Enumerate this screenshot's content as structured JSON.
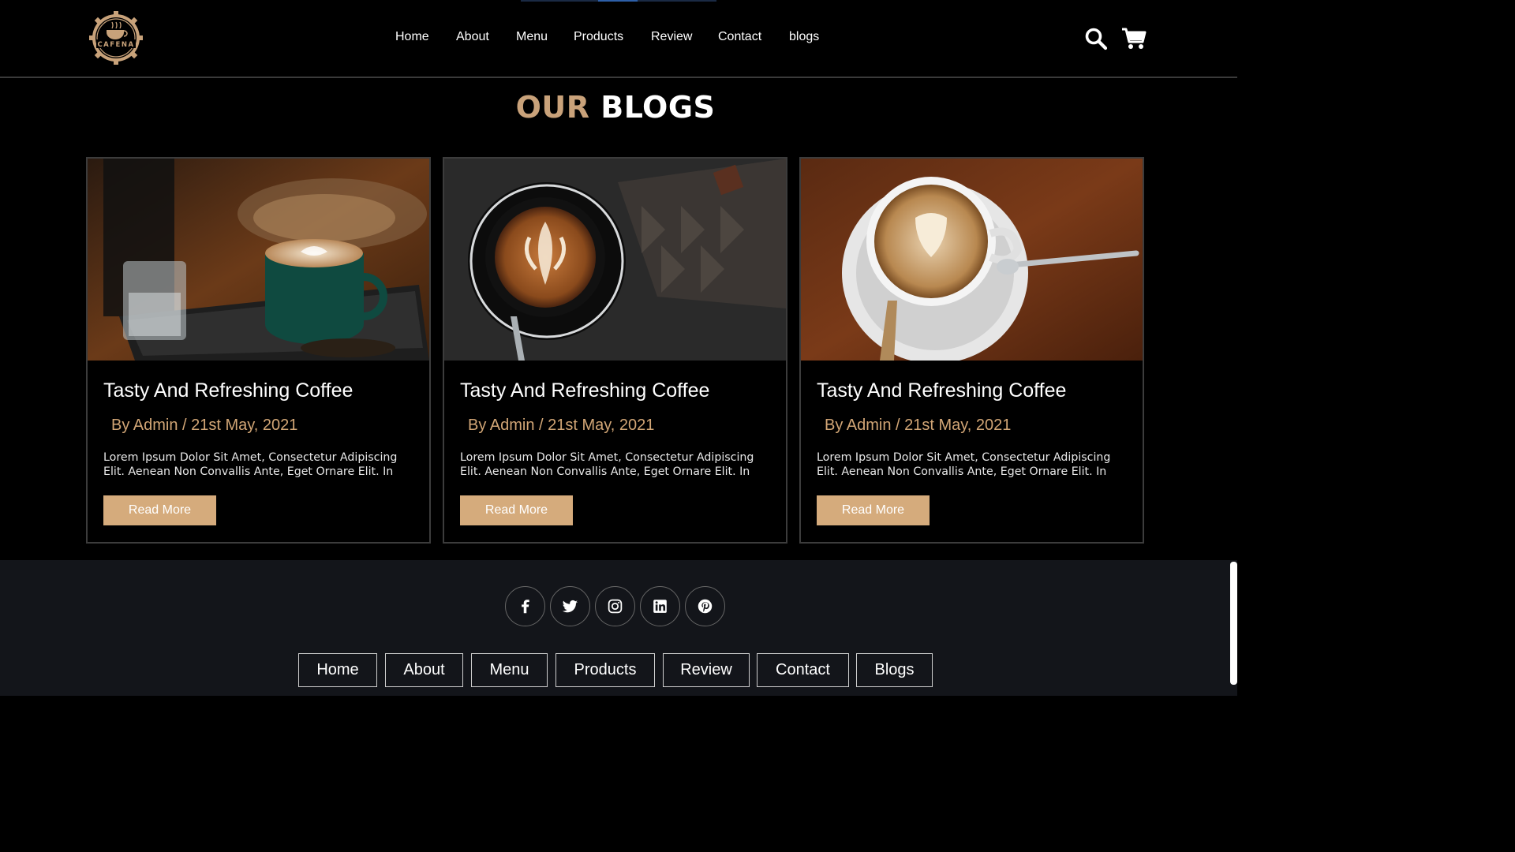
{
  "brand": {
    "logo_text": "CAFENA"
  },
  "nav": {
    "items": [
      "Home",
      "About",
      "Menu",
      "Products",
      "Review",
      "Contact",
      "blogs"
    ]
  },
  "header_icons": [
    "search-icon",
    "cart-icon"
  ],
  "section": {
    "title_accent": "OUR",
    "title_rest": "BLOGS"
  },
  "blogs": [
    {
      "title": "Tasty And Refreshing Coffee",
      "meta": "By Admin / 21st May, 2021",
      "excerpt": "Lorem Ipsum Dolor Sit Amet, Consectetur Adipiscing Elit. Aenean Non Convallis Ante, Eget Ornare Elit. In",
      "button": "Read More"
    },
    {
      "title": "Tasty And Refreshing Coffee",
      "meta": "By Admin / 21st May, 2021",
      "excerpt": "Lorem Ipsum Dolor Sit Amet, Consectetur Adipiscing Elit. Aenean Non Convallis Ante, Eget Ornare Elit. In",
      "button": "Read More"
    },
    {
      "title": "Tasty And Refreshing Coffee",
      "meta": "By Admin / 21st May, 2021",
      "excerpt": "Lorem Ipsum Dolor Sit Amet, Consectetur Adipiscing Elit. Aenean Non Convallis Ante, Eget Ornare Elit. In",
      "button": "Read More"
    }
  ],
  "footer": {
    "social": [
      "facebook-icon",
      "twitter-icon",
      "instagram-icon",
      "linkedin-icon",
      "pinterest-icon"
    ],
    "links": [
      "Home",
      "About",
      "Menu",
      "Products",
      "Review",
      "Contact",
      "Blogs"
    ]
  },
  "colors": {
    "accent": "#d5ab7c",
    "background": "#000000",
    "footer_bg": "#13151a"
  }
}
